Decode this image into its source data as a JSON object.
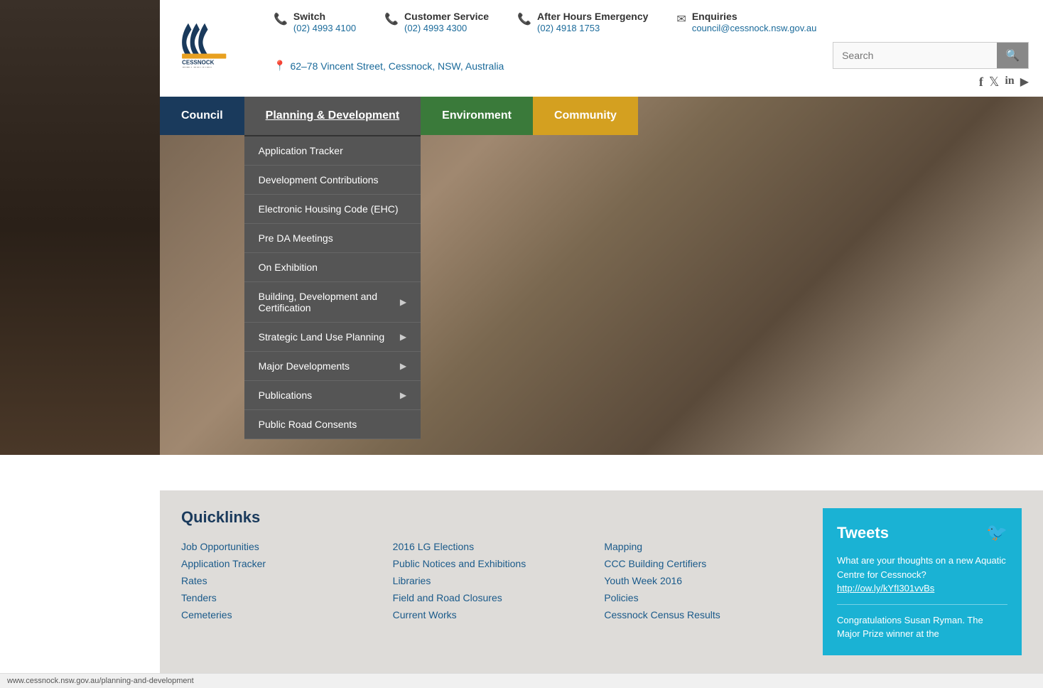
{
  "header": {
    "logo_alt": "Cessnock City Council",
    "contacts": [
      {
        "id": "switch",
        "icon": "📞",
        "label": "Switch",
        "phone": "(02) 4993 4100"
      },
      {
        "id": "customer-service",
        "icon": "📞",
        "label": "Customer Service",
        "phone": "(02) 4993 4300"
      },
      {
        "id": "after-hours",
        "icon": "📞",
        "label": "After Hours Emergency",
        "phone": "(02) 4918 1753"
      },
      {
        "id": "enquiries",
        "icon": "✉",
        "label": "Enquiries",
        "email": "council@cessnock.nsw.gov.au"
      }
    ],
    "address": "62–78 Vincent Street, Cessnock, NSW, Australia",
    "search_placeholder": "Search",
    "social": [
      "f",
      "🐦",
      "in",
      "▶"
    ]
  },
  "nav": {
    "items": [
      {
        "id": "council",
        "label": "Council",
        "active": false
      },
      {
        "id": "planning",
        "label": "Planning & Development",
        "active": true
      },
      {
        "id": "environment",
        "label": "Environment",
        "active": false
      },
      {
        "id": "community",
        "label": "Community",
        "active": false
      }
    ]
  },
  "dropdown": {
    "items": [
      {
        "id": "application-tracker",
        "label": "Application Tracker",
        "has_arrow": false
      },
      {
        "id": "development-contributions",
        "label": "Development Contributions",
        "has_arrow": false
      },
      {
        "id": "electronic-housing-code",
        "label": "Electronic Housing Code (EHC)",
        "has_arrow": false
      },
      {
        "id": "pre-da-meetings",
        "label": "Pre DA Meetings",
        "has_arrow": false
      },
      {
        "id": "on-exhibition",
        "label": "On Exhibition",
        "has_arrow": false
      },
      {
        "id": "building-development",
        "label": "Building, Development and Certification",
        "has_arrow": true
      },
      {
        "id": "strategic-land-use",
        "label": "Strategic Land Use Planning",
        "has_arrow": true
      },
      {
        "id": "major-developments",
        "label": "Major Developments",
        "has_arrow": true
      },
      {
        "id": "publications",
        "label": "Publications",
        "has_arrow": true
      },
      {
        "id": "public-road-consents",
        "label": "Public Road Consents",
        "has_arrow": false
      }
    ]
  },
  "quicklinks": {
    "title": "Quicklinks",
    "items": [
      {
        "id": "job-opportunities",
        "label": "Job Opportunities"
      },
      {
        "id": "2016-lg-elections",
        "label": "2016 LG Elections"
      },
      {
        "id": "mapping",
        "label": "Mapping"
      },
      {
        "id": "application-tracker-ql",
        "label": "Application Tracker"
      },
      {
        "id": "public-notices",
        "label": "Public Notices and Exhibitions"
      },
      {
        "id": "ccc-building-certifiers",
        "label": "CCC Building Certifiers"
      },
      {
        "id": "rates",
        "label": "Rates"
      },
      {
        "id": "libraries",
        "label": "Libraries"
      },
      {
        "id": "youth-week-2016",
        "label": "Youth Week 2016"
      },
      {
        "id": "tenders",
        "label": "Tenders"
      },
      {
        "id": "field-and-road-closures",
        "label": "Field and Road Closures"
      },
      {
        "id": "policies",
        "label": "Policies"
      },
      {
        "id": "cemeteries",
        "label": "Cemeteries"
      },
      {
        "id": "current-works",
        "label": "Current Works"
      },
      {
        "id": "cessnock-census-results",
        "label": "Cessnock Census Results"
      }
    ]
  },
  "tweets": {
    "title": "Tweets",
    "tweet1_text": "What are your thoughts on a new Aquatic Centre for Cessnock?",
    "tweet1_link": "http://ow.ly/kYfI301vvBs",
    "tweet2_text": "Congratulations Susan Ryman. The Major Prize winner at the"
  },
  "status_bar": {
    "url": "www.cessnock.nsw.gov.au/planning-and-development"
  }
}
